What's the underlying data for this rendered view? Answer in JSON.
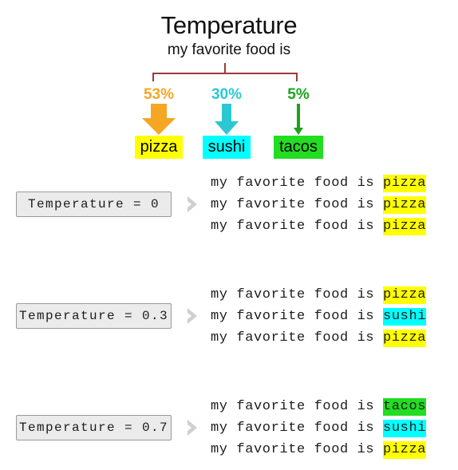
{
  "header": {
    "title": "Temperature",
    "subtitle": "my favorite food is"
  },
  "colors": {
    "pizza_bg": "#ffff00",
    "sushi_bg": "#00ffff",
    "tacos_bg": "#22dd22",
    "pizza_arrow": "#f5a623",
    "sushi_arrow": "#2bc8d4",
    "tacos_arrow": "#1aa31a",
    "brace": "#9c3a3a",
    "chevron": "#cfcfcf",
    "box_bg": "#ebebeb",
    "box_border": "#9a9a9a"
  },
  "distribution": [
    {
      "percent": "53%",
      "token": "pizza",
      "pct_color": "#f5a623",
      "arrow_color": "#f5a623",
      "box_color": "#ffff00",
      "arrow_weight": "thick"
    },
    {
      "percent": "30%",
      "token": "sushi",
      "pct_color": "#2bc8d4",
      "arrow_color": "#2bc8d4",
      "box_color": "#00ffff",
      "arrow_weight": "medium"
    },
    {
      "percent": "5%",
      "token": "tacos",
      "pct_color": "#1aa31a",
      "arrow_color": "#1aa31a",
      "box_color": "#22dd22",
      "arrow_weight": "thin"
    }
  ],
  "rows": [
    {
      "temperature_label": "Temperature = 0",
      "samples": [
        {
          "prefix": "my favorite food is ",
          "token": "pizza",
          "token_color": "#ffff00"
        },
        {
          "prefix": "my favorite food is ",
          "token": "pizza",
          "token_color": "#ffff00"
        },
        {
          "prefix": "my favorite food is ",
          "token": "pizza",
          "token_color": "#ffff00"
        }
      ]
    },
    {
      "temperature_label": "Temperature = 0.3",
      "samples": [
        {
          "prefix": "my favorite food is ",
          "token": "pizza",
          "token_color": "#ffff00"
        },
        {
          "prefix": "my favorite food is ",
          "token": "sushi",
          "token_color": "#00ffff"
        },
        {
          "prefix": "my favorite food is ",
          "token": "pizza",
          "token_color": "#ffff00"
        }
      ]
    },
    {
      "temperature_label": "Temperature = 0.7",
      "samples": [
        {
          "prefix": "my favorite food is ",
          "token": "tacos",
          "token_color": "#22dd22"
        },
        {
          "prefix": "my favorite food is ",
          "token": "sushi",
          "token_color": "#00ffff"
        },
        {
          "prefix": "my favorite food is ",
          "token": "pizza",
          "token_color": "#ffff00"
        }
      ]
    }
  ]
}
